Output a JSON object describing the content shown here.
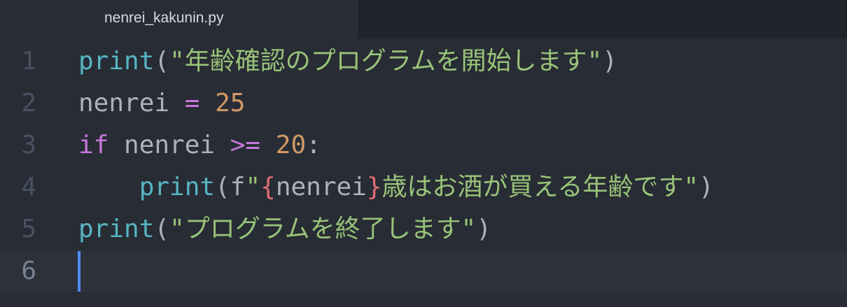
{
  "tab": {
    "title": "nenrei_kakunin.py"
  },
  "lines": [
    {
      "number": "1",
      "tokens": [
        {
          "type": "fn",
          "text": "print"
        },
        {
          "type": "plain",
          "text": "("
        },
        {
          "type": "str",
          "text": "\"年齢確認のプログラムを開始します\""
        },
        {
          "type": "plain",
          "text": ")"
        }
      ]
    },
    {
      "number": "2",
      "tokens": [
        {
          "type": "plain",
          "text": "nenrei "
        },
        {
          "type": "op",
          "text": "="
        },
        {
          "type": "plain",
          "text": " "
        },
        {
          "type": "num",
          "text": "25"
        }
      ]
    },
    {
      "number": "3",
      "tokens": [
        {
          "type": "kw",
          "text": "if"
        },
        {
          "type": "plain",
          "text": " nenrei "
        },
        {
          "type": "op",
          "text": ">="
        },
        {
          "type": "plain",
          "text": " "
        },
        {
          "type": "num",
          "text": "20"
        },
        {
          "type": "plain",
          "text": ":"
        }
      ]
    },
    {
      "number": "4",
      "tokens": [
        {
          "type": "plain",
          "text": "    "
        },
        {
          "type": "fn",
          "text": "print"
        },
        {
          "type": "plain",
          "text": "(f"
        },
        {
          "type": "str",
          "text": "\""
        },
        {
          "type": "brace",
          "text": "{"
        },
        {
          "type": "plain",
          "text": "nenrei"
        },
        {
          "type": "brace",
          "text": "}"
        },
        {
          "type": "str",
          "text": "歳はお酒が買える年齢です\""
        },
        {
          "type": "plain",
          "text": ")"
        }
      ]
    },
    {
      "number": "5",
      "tokens": [
        {
          "type": "fn",
          "text": "print"
        },
        {
          "type": "plain",
          "text": "("
        },
        {
          "type": "str",
          "text": "\"プログラムを終了します\""
        },
        {
          "type": "plain",
          "text": ")"
        }
      ]
    },
    {
      "number": "6",
      "tokens": []
    }
  ],
  "colors": {
    "background": "#282c34",
    "function": "#56b6c2",
    "string": "#98c379",
    "keyword": "#c678dd",
    "number": "#d19a66",
    "brace": "#e06c75",
    "cursor": "#528bff"
  }
}
